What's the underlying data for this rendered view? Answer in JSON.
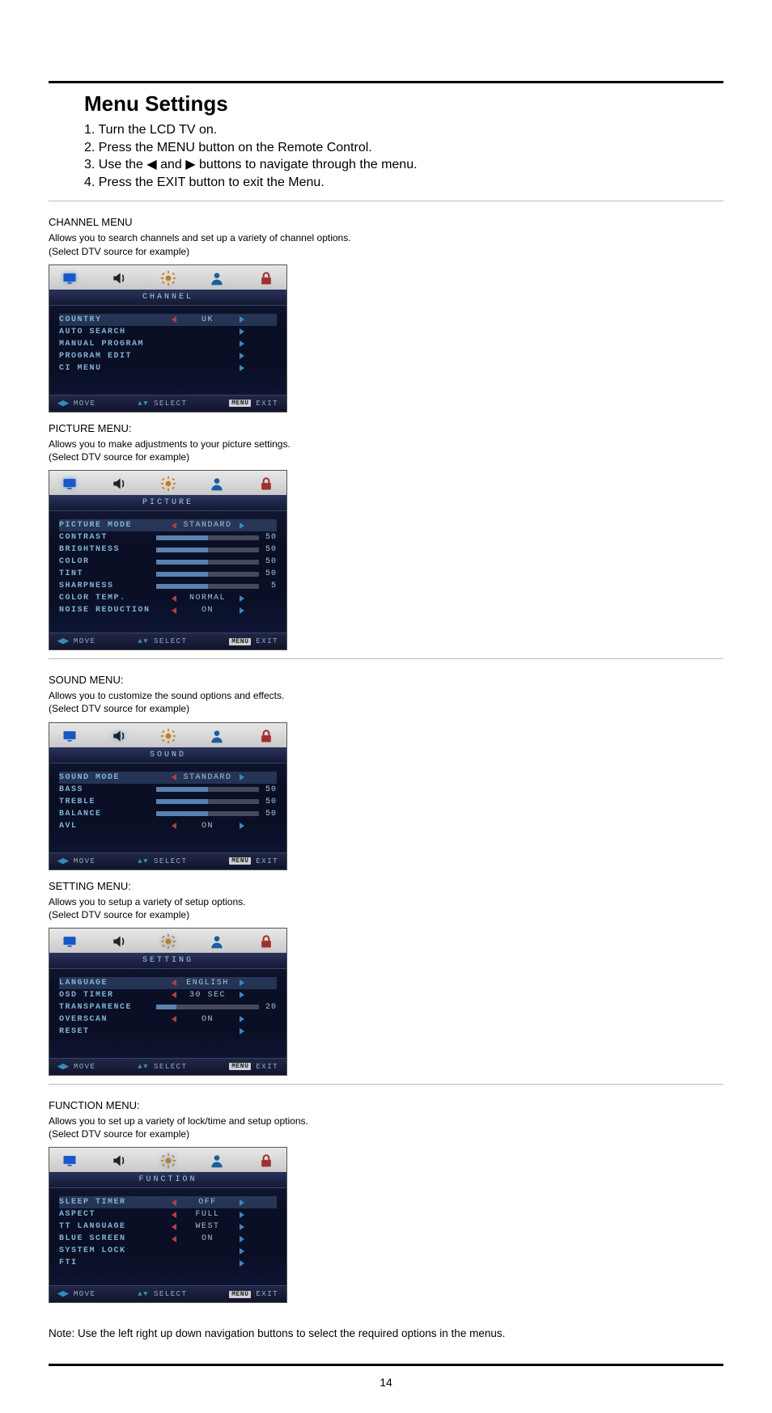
{
  "page_number": "14",
  "heading": "Menu Settings",
  "steps": [
    "1. Turn the LCD TV on.",
    "2. Press the MENU button on the Remote Control.",
    "3. Use the ◀ and ▶ buttons to navigate through the menu.",
    "4. Press the EXIT button to exit the Menu."
  ],
  "footer": {
    "move": "MOVE",
    "select": "SELECT",
    "exit": "EXIT",
    "menu_badge": "MENU"
  },
  "note": "Note: Use the left right up down navigation buttons to select the required options in the menus.",
  "sections": {
    "channel": {
      "title": "CHANNEL MENU",
      "desc_l1": "Allows you to search channels and set up a variety of channel options.",
      "desc_l2": "(Select DTV source for example)",
      "menu_title": "CHANNEL",
      "items": [
        {
          "label": "COUNTRY",
          "type": "lr",
          "value": "UK",
          "selected": true
        },
        {
          "label": "AUTO SEARCH",
          "type": "r"
        },
        {
          "label": "MANUAL PROGRAM",
          "type": "r"
        },
        {
          "label": "PROGRAM EDIT",
          "type": "r"
        },
        {
          "label": "CI MENU",
          "type": "r"
        }
      ]
    },
    "picture": {
      "title": "PICTURE MENU:",
      "desc_l1": "Allows you to make adjustments to your picture settings.",
      "desc_l2": "(Select DTV source for example)",
      "menu_title": "PICTURE",
      "items": [
        {
          "label": "PICTURE MODE",
          "type": "lr",
          "value": "STANDARD",
          "selected": true
        },
        {
          "label": "CONTRAST",
          "type": "slider",
          "num": "50",
          "pct": 50
        },
        {
          "label": "BRIGHTNESS",
          "type": "slider",
          "num": "50",
          "pct": 50
        },
        {
          "label": "COLOR",
          "type": "slider",
          "num": "50",
          "pct": 50
        },
        {
          "label": "TINT",
          "type": "slider",
          "num": "50",
          "pct": 50
        },
        {
          "label": "SHARPNESS",
          "type": "slider",
          "num": "5",
          "pct": 50
        },
        {
          "label": "COLOR TEMP.",
          "type": "lr",
          "value": "NORMAL"
        },
        {
          "label": "NOISE REDUCTION",
          "type": "lr",
          "value": "ON"
        }
      ]
    },
    "sound": {
      "title": "SOUND MENU:",
      "desc_l1": "Allows you to customize the sound options and effects.",
      "desc_l2": "(Select DTV source for example)",
      "menu_title": "SOUND",
      "items": [
        {
          "label": "SOUND MODE",
          "type": "lr",
          "value": "STANDARD",
          "selected": true
        },
        {
          "label": "BASS",
          "type": "slider",
          "num": "50",
          "pct": 50
        },
        {
          "label": "TREBLE",
          "type": "slider",
          "num": "50",
          "pct": 50
        },
        {
          "label": "BALANCE",
          "type": "slider",
          "num": "50",
          "pct": 50
        },
        {
          "label": "AVL",
          "type": "lr",
          "value": "ON"
        }
      ]
    },
    "setting": {
      "title": "SETTING MENU:",
      "desc_l1": "Allows you to setup a variety of setup options.",
      "desc_l2": "(Select DTV source for example)",
      "menu_title": "SETTING",
      "items": [
        {
          "label": "LANGUAGE",
          "type": "lr",
          "value": "ENGLISH",
          "selected": true
        },
        {
          "label": "OSD TIMER",
          "type": "lr",
          "value": "30 SEC"
        },
        {
          "label": "TRANSPARENCE",
          "type": "slider",
          "num": "20",
          "pct": 20
        },
        {
          "label": "OVERSCAN",
          "type": "lr",
          "value": "ON"
        },
        {
          "label": "RESET",
          "type": "r"
        }
      ]
    },
    "function": {
      "title": "FUNCTION MENU:",
      "desc_l1": "Allows you to set up a variety of lock/time and setup options.",
      "desc_l2": "(Select DTV source for example)",
      "menu_title": "FUNCTION",
      "items": [
        {
          "label": "SLEEP TIMER",
          "type": "lr",
          "value": "OFF",
          "selected": true
        },
        {
          "label": "ASPECT",
          "type": "lr",
          "value": "FULL"
        },
        {
          "label": "TT LANGUAGE",
          "type": "lr",
          "value": "WEST"
        },
        {
          "label": "BLUE SCREEN",
          "type": "lr",
          "value": "ON"
        },
        {
          "label": "SYSTEM LOCK",
          "type": "r"
        },
        {
          "label": "FTI",
          "type": "r"
        }
      ]
    }
  },
  "icons": {
    "tv": {
      "name": "tv-icon",
      "color": "#1858c8"
    },
    "snd": {
      "name": "sound-icon",
      "color": "#222"
    },
    "set": {
      "name": "gear-icon",
      "color": "#c87a1a"
    },
    "fun": {
      "name": "avatar-icon",
      "color": "#1a5da0"
    },
    "lock": {
      "name": "lock-icon",
      "color": "#a03030"
    }
  }
}
